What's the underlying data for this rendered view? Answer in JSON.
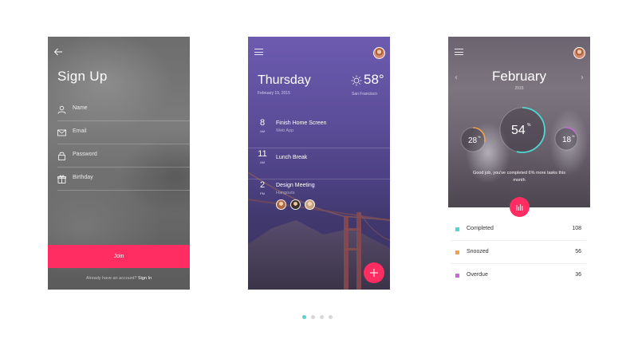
{
  "signup": {
    "title": "Sign Up",
    "fields": [
      {
        "label": "Name",
        "icon": "user-icon"
      },
      {
        "label": "Email",
        "icon": "mail-icon"
      },
      {
        "label": "Password",
        "icon": "lock-icon"
      },
      {
        "label": "Birthday",
        "icon": "gift-icon"
      }
    ],
    "join_label": "Join",
    "signin_prompt": "Already have an account?",
    "signin_link": "Sign In"
  },
  "calendar": {
    "day": "Thursday",
    "date": "February 19, 2015",
    "temperature": "58°",
    "city": "San Francisco",
    "events": [
      {
        "hour": "8",
        "ampm": "AM",
        "title": "Finish Home Screen",
        "subtitle": "Web App"
      },
      {
        "hour": "11",
        "ampm": "AM",
        "title": "Lunch Break",
        "subtitle": ""
      },
      {
        "hour": "2",
        "ampm": "PM",
        "title": "Design Meeting",
        "subtitle": "Hangouts"
      }
    ]
  },
  "stats": {
    "month": "February",
    "year": "2015",
    "prev_icon": "chevron-left-icon",
    "next_icon": "chevron-right-icon",
    "rings": [
      {
        "value": "28",
        "unit": "%",
        "fraction": 0.28,
        "color": "#f5a04a"
      },
      {
        "value": "54",
        "unit": "%",
        "fraction": 0.54,
        "color": "#4fd8d2"
      },
      {
        "value": "18",
        "unit": "%",
        "fraction": 0.18,
        "color": "#c768d6"
      }
    ],
    "message": "Good job, you've completed 6% more tasks this month",
    "legend": [
      {
        "label": "Completed",
        "value": "108",
        "color": "#4fd8d2"
      },
      {
        "label": "Snoozed",
        "value": "56",
        "color": "#f5a04a"
      },
      {
        "label": "Overdue",
        "value": "36",
        "color": "#c768d6"
      }
    ]
  },
  "colors": {
    "accent": "#ff2d62",
    "teal": "#4fd8d2",
    "pager_active": "#5bd0cf"
  },
  "pager": {
    "count": 4,
    "active": 0
  }
}
